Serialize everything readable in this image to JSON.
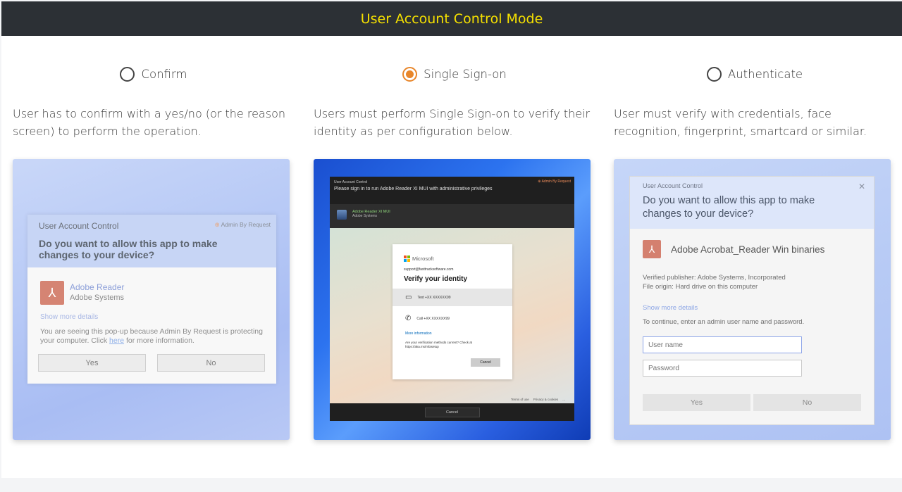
{
  "header": {
    "title": "User Account Control Mode"
  },
  "colors": {
    "header_bg": "#2c3035",
    "header_text": "#f5e000",
    "radio_selected": "#e8862a"
  },
  "options": [
    {
      "label": "Confirm",
      "selected": false,
      "description": "User has to confirm with a yes/no (or the reason screen) to perform the operation.",
      "preview": {
        "window_title": "User Account Control",
        "brand": "Admin By Request",
        "question": "Do you want to allow this app to make changes to your device?",
        "app_name": "Adobe Reader",
        "publisher": "Adobe Systems",
        "show_more": "Show more details",
        "info_before": "You are seeing this pop-up because Admin By Request is protecting your computer. Click",
        "info_link": "here",
        "info_after": "for more information.",
        "yes": "Yes",
        "no": "No"
      }
    },
    {
      "label": "Single Sign-on",
      "selected": true,
      "description": "Users must perform Single Sign-on to verify their identity as per configuration below.",
      "preview": {
        "window_title": "User Account Control",
        "brand": "Admin By Request",
        "prompt": "Please sign in to run Adobe Reader XI  MUI with administrative privileges",
        "app_name": "Adobe Reader XI  MUI",
        "publisher": "Adobe Systems",
        "ms_brand": "Microsoft",
        "email": "support@fasttracksoftware.com",
        "verify_title": "Verify your identity",
        "text_option": "Text +XX XXXXXX99",
        "call_option": "Call +XX XXXXXX99",
        "more_info": "More information",
        "methods_question": "Are your verification methods current? Check at https://aka.ms/mfasetup",
        "card_cancel": "Cancel",
        "terms": "Terms of use",
        "privacy": "Privacy & cookies",
        "ellipsis": "...",
        "bottom_cancel": "Cancel"
      }
    },
    {
      "label": "Authenticate",
      "selected": false,
      "description": "User must verify with credentials, face recognition, fingerprint, smartcard or similar.",
      "preview": {
        "window_title": "User Account Control",
        "close_glyph": "✕",
        "question": "Do you want to allow this app to make changes to your device?",
        "app_name": "Adobe Acrobat_Reader Win binaries",
        "verified_publisher": "Verified publisher: Adobe Systems, Incorporated",
        "file_origin": "File origin: Hard drive on this computer",
        "show_more": "Show more details",
        "continue_text": "To continue, enter an admin user name and password.",
        "username_placeholder": "User name",
        "password_placeholder": "Password",
        "yes": "Yes",
        "no": "No"
      }
    }
  ],
  "icons": {
    "radio": "radio-icon",
    "pdf": "pdf-icon",
    "close": "close-icon",
    "chat": "chat-icon",
    "phone": "phone-icon"
  }
}
